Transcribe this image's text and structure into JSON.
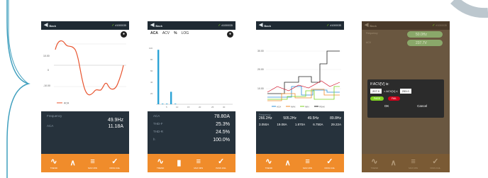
{
  "common": {
    "back_label": "Back",
    "serial": "#1000035",
    "tool_labels": [
      "TREND",
      "",
      "MAX MIN",
      "PASS FAIL"
    ]
  },
  "phone1": {
    "y_ticks": [
      "10.00",
      "0",
      "-10.00"
    ],
    "legend": "ACA",
    "freq_label": "Frequency",
    "freq_value": "49.9Hz",
    "aca_label": "ACA",
    "aca_value": "11.18A"
  },
  "phone2": {
    "tabs": [
      "ACA",
      "ACV",
      "%",
      "LOG"
    ],
    "y_ticks": [
      "100",
      "80",
      "60",
      "40",
      "20"
    ],
    "x_ticks": [
      "5",
      "10",
      "15",
      "20",
      "25",
      "30"
    ],
    "rows": [
      {
        "label": "ACA",
        "value": "78.80A"
      },
      {
        "label": "THD-F",
        "value": "25.3%"
      },
      {
        "label": "THD-R",
        "value": "24.5%"
      },
      {
        "label": "h",
        "value": "100.0%"
      }
    ],
    "chart_data": {
      "type": "bar",
      "categories": [
        "1",
        "2",
        "3",
        "4",
        "5"
      ],
      "values": [
        96,
        1,
        1,
        22,
        1
      ],
      "ylim": [
        0,
        100
      ]
    }
  },
  "phone3": {
    "y_ticks": [
      "30.00",
      "20.00",
      "10.00"
    ],
    "legend": [
      "ACA",
      "MAX",
      "MIN",
      "PEAK"
    ],
    "freq_values": [
      "266.2Hz",
      "505.2Hz",
      "49.5Hz",
      "89.8Hz"
    ],
    "aca_values": [
      "3.050A",
      "19.08A",
      "1.870A",
      "6.750A",
      "29.22A"
    ],
    "freq_label": "Frequency"
  },
  "phone4": {
    "freq_label": "Frequency",
    "freq_value": "50.0Hz",
    "acv_label": "ACV",
    "acv_value": "237.7V",
    "dialog_title": "If ACV[V] is:",
    "low": "207.0",
    "high": "253.0",
    "cond": "< ACV[V] ≤",
    "pass_label": "PASS",
    "fail_label": "FAIL",
    "ok_label": "OK",
    "cancel_label": "Cancel"
  }
}
